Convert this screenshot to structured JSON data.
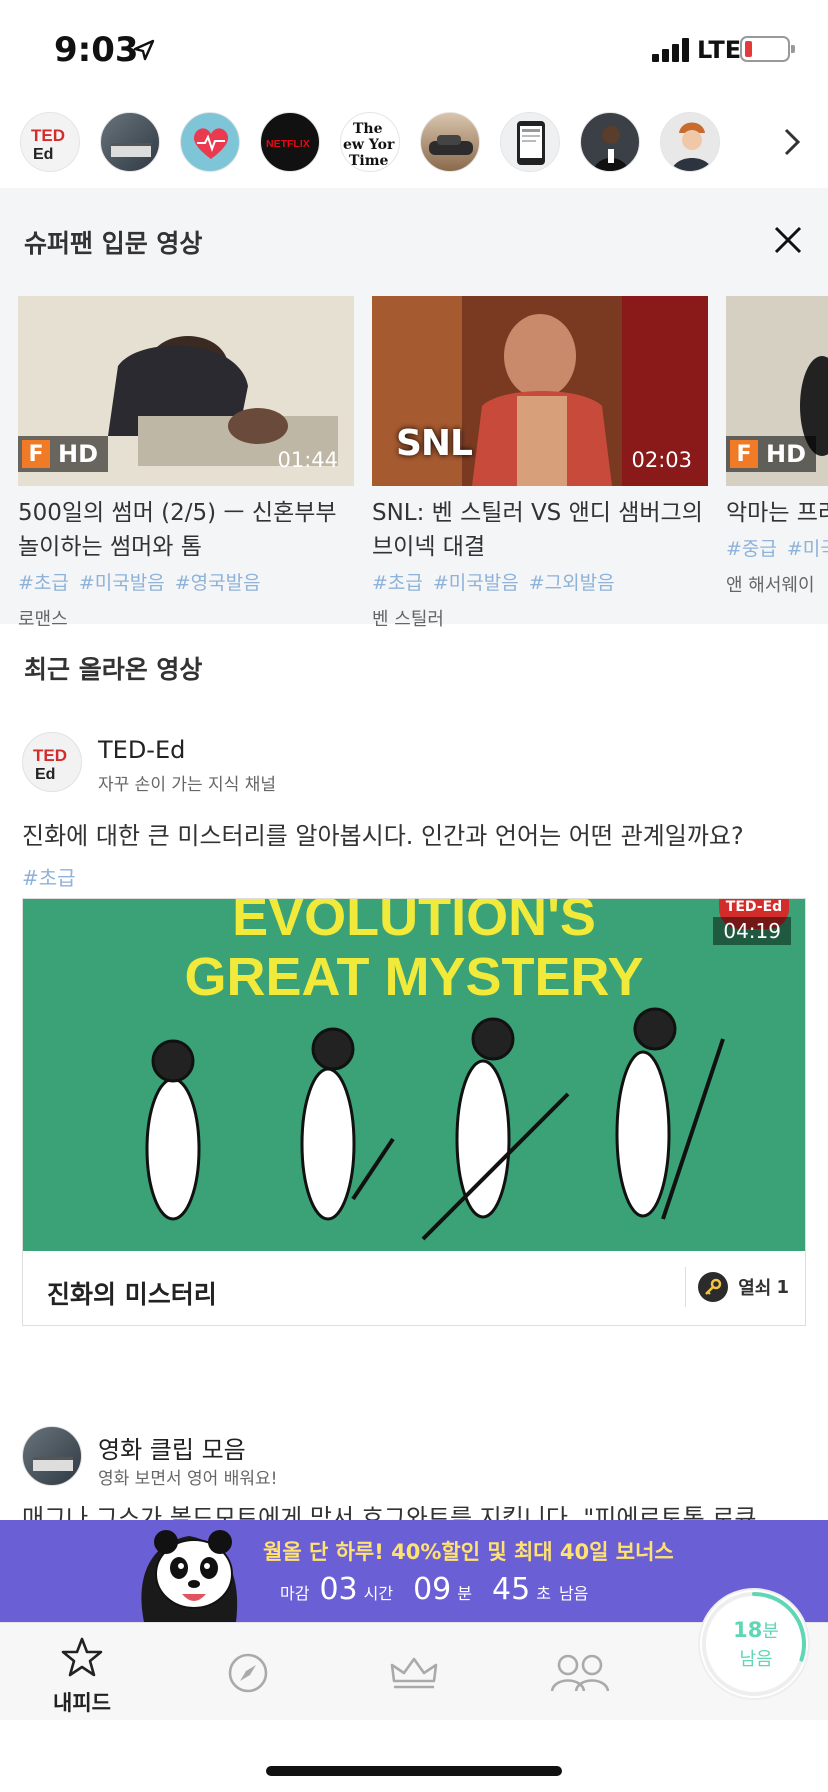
{
  "status": {
    "time": "9:03",
    "network": "LTE"
  },
  "channels": {
    "items": [
      "ted-ed",
      "movie-clips",
      "health",
      "netflix",
      "new-york-times",
      "car",
      "news-phone",
      "person",
      "conan"
    ]
  },
  "suggest": {
    "title": "슈퍼팬 입문 영상",
    "cards": [
      {
        "title": "500일의 썸머 (2/5) ㅡ 신혼부부 놀이하는 썸머와 톰",
        "duration": "01:44",
        "badge": "HD",
        "tags": [
          "#초급",
          "#미국발음",
          "#영국발음"
        ],
        "sub": "로맨스"
      },
      {
        "title": "SNL: 벤 스틸러 VS 앤디 샘버그의 브이넥 대결",
        "duration": "02:03",
        "badge": "SNL",
        "tags": [
          "#초급",
          "#미국발음",
          "#그외발음"
        ],
        "sub": "벤 스틸러"
      },
      {
        "title": "악마는 프라",
        "duration": "",
        "badge": "HD",
        "tags": [
          "#중급",
          "#미국"
        ],
        "sub": "앤 해서웨이"
      }
    ]
  },
  "recent": {
    "title": "최근 올라온 영상",
    "post1": {
      "avatar_text": "TED Ed",
      "name": "TED-Ed",
      "desc": "자꾸 손이 가는 지식 채널",
      "text": "진화에 대한 큰 미스터리를 알아봅시다. 인간과 언어는 어떤 관계일까요?",
      "tag": "#초급",
      "thumb_line1": "EVOLUTION'S",
      "thumb_line2": "GREAT MYSTERY",
      "corner": "TED-Ed",
      "duration": "04:19",
      "video_title": "진화의 미스터리",
      "key_label": "열쇠",
      "key_count": "1"
    },
    "post2": {
      "name": "영화 클립 모음",
      "desc": "영화 보면서 영어 배워요!",
      "text": "매그나 그스가 볼드모트에게 맞서 호그와트를 지킵니다. \"피에르토톰 로큐"
    }
  },
  "promo": {
    "text": "월올 단 하루! 40%할인 및 최대 40일 보너스",
    "prefix": "마감",
    "hours": "03",
    "hours_unit": "시간",
    "minutes": "09",
    "minutes_unit": "분",
    "seconds": "45",
    "seconds_unit": "초",
    "suffix": "남음"
  },
  "tabbar": {
    "feed_label": "내피드"
  },
  "timer_badge": {
    "value": "18",
    "unit": "분",
    "label": "남음",
    "progress": 0.3
  },
  "colors": {
    "accent": "#6b5fd6",
    "tag": "#8fb2d8",
    "promo_text": "#ffe270",
    "timer": "#5fd6b4"
  }
}
